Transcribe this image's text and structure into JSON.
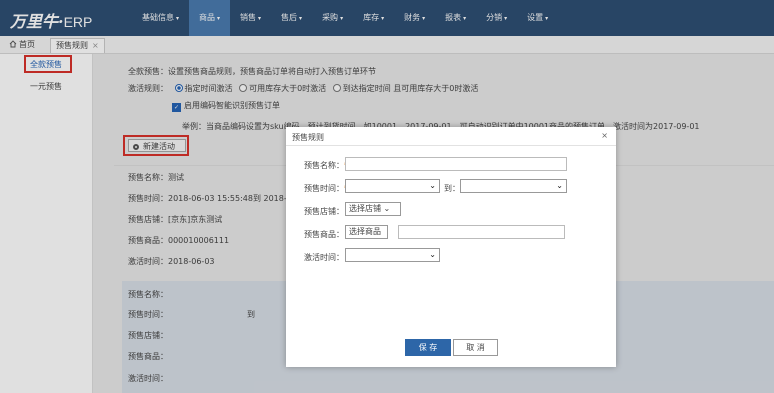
{
  "app": {
    "logo": "万里牛",
    "logo_sep": "·",
    "logo_suffix": "ERP"
  },
  "nav": [
    {
      "label": "基础信息"
    },
    {
      "label": "商品"
    },
    {
      "label": "销售"
    },
    {
      "label": "售后"
    },
    {
      "label": "采购"
    },
    {
      "label": "库存"
    },
    {
      "label": "财务"
    },
    {
      "label": "报表"
    },
    {
      "label": "分销"
    },
    {
      "label": "设置"
    }
  ],
  "nav_caret": "▾",
  "tabs": {
    "home": "首页",
    "current": "预售规则",
    "close": "×"
  },
  "sidebar": {
    "items": [
      {
        "label": "全款预售"
      },
      {
        "label": "一元预售"
      }
    ]
  },
  "main": {
    "desc_label": "全款预售：",
    "desc_text": "设置预售商品规则，预售商品订单将自动打入预售订单环节",
    "activate_label": "激活规则：",
    "options": [
      "指定时间激活",
      "可用库存大于0时激活",
      "到达指定时间 且可用库存大于0时激活"
    ],
    "checkbox_label": "启用编码智能识别预售订单",
    "example": "举例：当商品编码设置为sku编码，预计到货时间，如10001，2017-09-01，可自动识别订单中10001商品的预售订单，激活时间为2017-09-01",
    "new_button": "新建活动",
    "record": {
      "name_label": "预售名称：",
      "name": "测试",
      "time_label": "预售时间：",
      "time": "2018-06-03 15:55:48到 2018-06",
      "shop_label": "预售店铺：",
      "shop": "[京东]京东测试",
      "product_label": "预售商品：",
      "product": "000010006111",
      "activate_label": "激活时间：",
      "activate": "2018-06-03"
    },
    "panel": {
      "name_label": "预售名称：",
      "time_label": "预售时间：",
      "to": "到",
      "shop_label": "预售店铺：",
      "product_label": "预售商品：",
      "activate_label": "激活时间："
    }
  },
  "modal": {
    "title": "预售规则",
    "close": "×",
    "required_mark": "*",
    "name_label": "预售名称：",
    "time_label": "预售时间：",
    "to_label": "到：",
    "shop_label": "预售店铺：",
    "shop_button": "选择店铺",
    "shop_caret": "⌄",
    "product_label": "预售商品：",
    "product_button": "选择商品",
    "activate_label": "激活时间：",
    "select_caret": "⌄",
    "save": "保 存",
    "cancel": "取 消"
  },
  "colors": {
    "topbar": "#2e4f74",
    "nav_active": "#4a7bb0",
    "accent": "#2d66a8",
    "highlight": "#d9322b",
    "required": "#e08020"
  }
}
